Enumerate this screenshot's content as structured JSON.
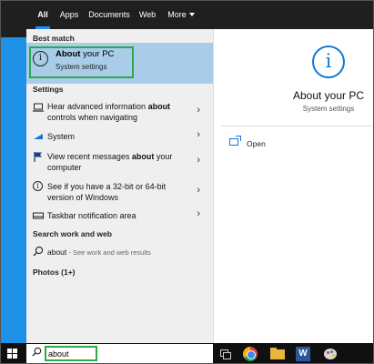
{
  "tabs": [
    {
      "label": "All",
      "active": true
    },
    {
      "label": "Apps",
      "active": false
    },
    {
      "label": "Documents",
      "active": false
    },
    {
      "label": "Web",
      "active": false
    },
    {
      "label": "More",
      "active": false
    }
  ],
  "best_match": {
    "header": "Best match",
    "title_bold": "About",
    "title_rest": " your PC",
    "subtitle": "System settings",
    "icon": "info-icon"
  },
  "settings": {
    "header": "Settings",
    "items": [
      {
        "icon": "laptop-icon",
        "line1_pre": "Hear advanced information ",
        "line1_bold": "about",
        "line2": "controls when navigating"
      },
      {
        "icon": "settings-system-icon",
        "line1_pre": "System",
        "line1_bold": "",
        "line2": ""
      },
      {
        "icon": "flag-icon",
        "line1_pre": "View recent messages ",
        "line1_bold": "about",
        "line1_post": " your",
        "line2": "computer"
      },
      {
        "icon": "info-icon",
        "line1_pre": "See if you have a 32-bit or 64-bit",
        "line1_bold": "",
        "line2": "version of Windows"
      },
      {
        "icon": "taskbar-icon",
        "line1_pre": "Taskbar notification area",
        "line1_bold": "",
        "line2": ""
      }
    ]
  },
  "search_web": {
    "header": "Search work and web",
    "query": "about",
    "suffix": " - See work and web results",
    "icon": "search-icon"
  },
  "photos": {
    "header": "Photos (1+)"
  },
  "preview": {
    "title": "About your PC",
    "subtitle": "System settings",
    "open_label": "Open",
    "icon": "info-icon"
  },
  "taskbar": {
    "search_value": "about",
    "apps": [
      "task-view-icon",
      "chrome-icon",
      "file-explorer-icon",
      "word-icon",
      "paint-icon"
    ]
  },
  "colors": {
    "accent": "#1478d4",
    "highlight": "#a9cde9",
    "annotation": "#2da84a",
    "desktop": "#1e90e6"
  }
}
